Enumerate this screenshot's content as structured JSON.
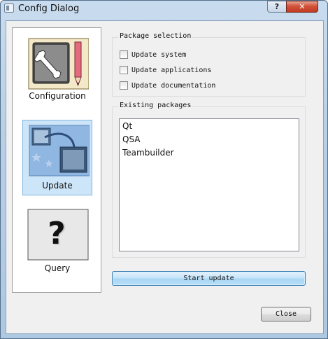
{
  "window": {
    "title": "Config Dialog",
    "help_label": "?",
    "close_label": "✕"
  },
  "nav": {
    "items": [
      {
        "label": "Configuration",
        "icon": "configuration-icon",
        "selected": false
      },
      {
        "label": "Update",
        "icon": "update-icon",
        "selected": true
      },
      {
        "label": "Query",
        "icon": "query-icon",
        "selected": false
      }
    ]
  },
  "package_selection": {
    "title": "Package selection",
    "options": [
      {
        "label": "Update system",
        "checked": false
      },
      {
        "label": "Update applications",
        "checked": false
      },
      {
        "label": "Update documentation",
        "checked": false
      }
    ]
  },
  "existing_packages": {
    "title": "Existing packages",
    "items": [
      "Qt",
      "QSA",
      "Teambuilder"
    ]
  },
  "buttons": {
    "start_update": "Start update",
    "close": "Close"
  },
  "colors": {
    "selection": "#cde5f8",
    "accent_border": "#3c7fb1"
  }
}
